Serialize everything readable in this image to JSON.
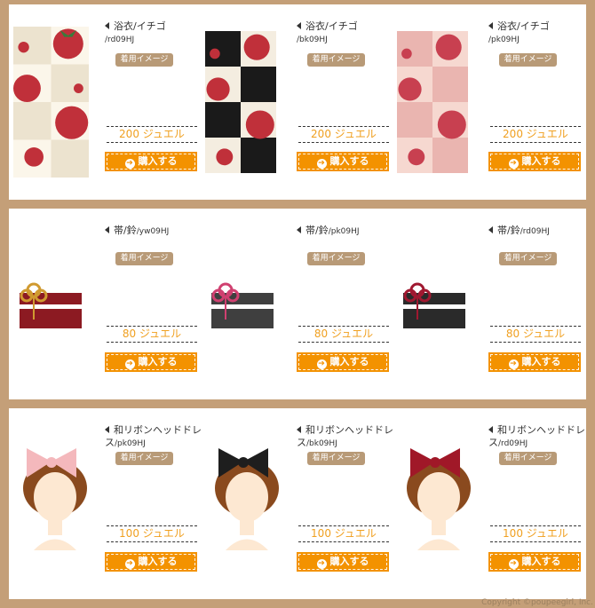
{
  "panels": [
    {
      "category": "yukata",
      "items": [
        {
          "name": "浴衣/イチゴ",
          "code": "/rd09HJ",
          "tag": "着用イメージ",
          "price": "200 ジュエル",
          "buy": "購入する",
          "bg": "#fbf6ea",
          "accent": "#c0303a",
          "alt": "#e8e2d0"
        },
        {
          "name": "浴衣/イチゴ",
          "code": "/bk09HJ",
          "tag": "着用イメージ",
          "price": "200 ジュエル",
          "buy": "購入する",
          "bg": "#f4ede0",
          "accent": "#c0303a",
          "alt": "#1a1a1a"
        },
        {
          "name": "浴衣/イチゴ",
          "code": "/pk09HJ",
          "tag": "着用イメージ",
          "price": "200 ジュエル",
          "buy": "購入する",
          "bg": "#f6d8d0",
          "accent": "#c84050",
          "alt": "#eab5b0"
        }
      ]
    },
    {
      "category": "obi",
      "items": [
        {
          "name": "帯/鈴",
          "code": "/yw09HJ",
          "tag": "着用イメージ",
          "price": "80 ジュエル",
          "buy": "購入する",
          "band": "#8c1a22",
          "knot": "#d09a30"
        },
        {
          "name": "帯/鈴",
          "code": "/pk09HJ",
          "tag": "着用イメージ",
          "price": "80 ジュエル",
          "buy": "購入する",
          "band": "#3f3f3f",
          "knot": "#d04070"
        },
        {
          "name": "帯/鈴",
          "code": "/rd09HJ",
          "tag": "着用イメージ",
          "price": "80 ジュエル",
          "buy": "購入する",
          "band": "#2a2a2a",
          "knot": "#a01830"
        }
      ]
    },
    {
      "category": "ribbon",
      "items": [
        {
          "name": "和リボンヘッドドレス",
          "code": "/pk09HJ",
          "tag": "着用イメージ",
          "price": "100 ジュエル",
          "buy": "購入する",
          "bow": "#f4b8bc"
        },
        {
          "name": "和リボンヘッドドレス",
          "code": "/bk09HJ",
          "tag": "着用イメージ",
          "price": "100 ジュエル",
          "buy": "購入する",
          "bow": "#1e1e1e"
        },
        {
          "name": "和リボンヘッドドレス",
          "code": "/rd09HJ",
          "tag": "着用イメージ",
          "price": "100 ジュエル",
          "buy": "購入する",
          "bow": "#a01828"
        }
      ]
    }
  ],
  "copyright": "Copyright ©poupeegirl, Inc."
}
